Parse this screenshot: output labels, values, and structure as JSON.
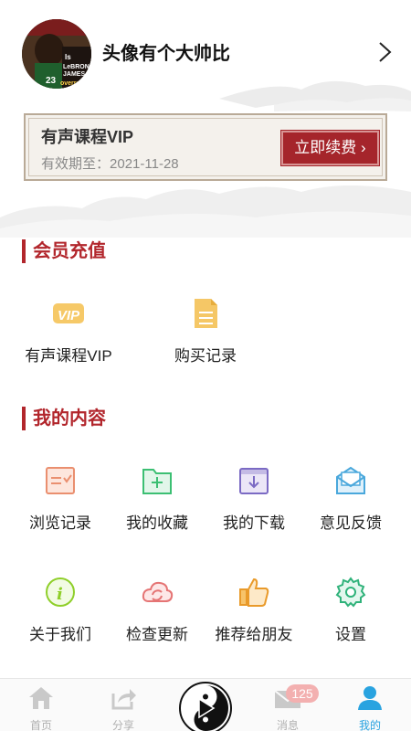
{
  "profile": {
    "nickname": "头像有个大帅比",
    "avatar_text": [
      "Is",
      "LeBRON",
      "JAMES",
      "overrated?"
    ]
  },
  "vip": {
    "title": "有声课程VIP",
    "expire_label": "有效期至：",
    "expire_date": "2021-11-28",
    "renew_label": "立即续费 ›"
  },
  "member_section": {
    "title": "会员充值",
    "items": [
      {
        "label": "有声课程VIP",
        "icon": "vip-icon"
      },
      {
        "label": "购买记录",
        "icon": "document-icon"
      }
    ]
  },
  "content_section": {
    "title": "我的内容",
    "items": [
      {
        "label": "浏览记录",
        "icon": "history-icon"
      },
      {
        "label": "我的收藏",
        "icon": "favorite-folder-icon"
      },
      {
        "label": "我的下载",
        "icon": "download-box-icon"
      },
      {
        "label": "意见反馈",
        "icon": "feedback-mail-icon"
      },
      {
        "label": "关于我们",
        "icon": "info-icon"
      },
      {
        "label": "检查更新",
        "icon": "cloud-refresh-icon"
      },
      {
        "label": "推荐给朋友",
        "icon": "thumbs-up-icon"
      },
      {
        "label": "设置",
        "icon": "gear-icon"
      }
    ]
  },
  "tabbar": {
    "tabs": [
      {
        "label": "首页",
        "icon": "home-icon"
      },
      {
        "label": "分享",
        "icon": "share-icon"
      },
      {
        "label": "",
        "icon": "yin-yang-play-icon"
      },
      {
        "label": "消息",
        "icon": "mail-icon",
        "badge": "125"
      },
      {
        "label": "我的",
        "icon": "user-icon",
        "active": true
      }
    ]
  },
  "colors": {
    "accent_red": "#b2262c",
    "active_blue": "#29a3e0",
    "badge_pink": "#f3b0b0"
  }
}
